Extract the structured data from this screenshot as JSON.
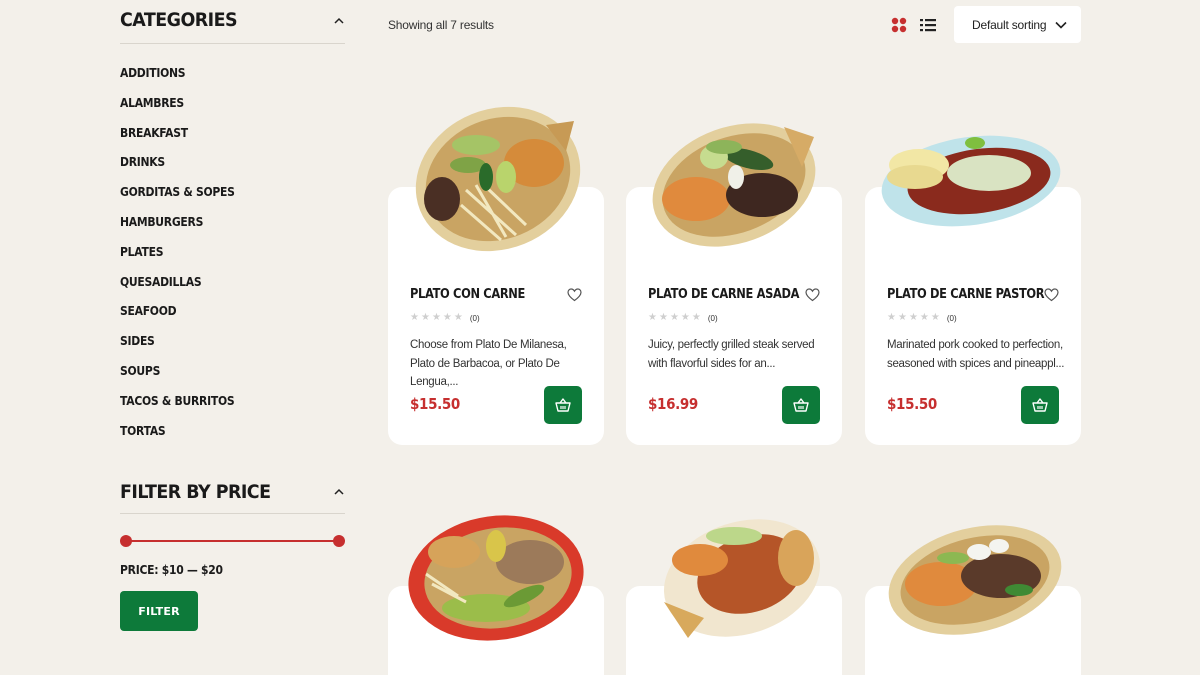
{
  "sidebar": {
    "categories_title": "CATEGORIES",
    "categories": [
      "ADDITIONS",
      "ALAMBRES",
      "BREAKFAST",
      "DRINKS",
      "GORDITAS & SOPES",
      "HAMBURGERS",
      "PLATES",
      "QUESADILLAS",
      "SEAFOOD",
      "SIDES",
      "SOUPS",
      "TACOS & BURRITOS",
      "TORTAS"
    ],
    "price_filter": {
      "title": "FILTER BY PRICE",
      "label": "PRICE: $10 — $20",
      "button": "FILTER"
    }
  },
  "toolbar": {
    "results_text": "Showing all 7 results",
    "sorting": "Default sorting",
    "view_icons": [
      "grid-view-icon",
      "list-view-icon"
    ]
  },
  "products": [
    {
      "title": "PLATO CON CARNE",
      "rating_count": "(0)",
      "description": "Choose from Plato De Milanesa, Plato de Barbacoa, or Plato De Lengua,...",
      "price": "$15.50",
      "stars": 0
    },
    {
      "title": "PLATO DE CARNE ASADA",
      "rating_count": "(0)",
      "description": "Juicy, perfectly grilled steak served with flavorful sides for an...",
      "price": "$16.99",
      "stars": 0
    },
    {
      "title": "PLATO DE CARNE PASTOR",
      "rating_count": "(0)",
      "description": "Marinated pork cooked to perfection, seasoned with spices and pineappl...",
      "price": "$15.50",
      "stars": 0
    }
  ],
  "colors": {
    "background": "#f3f0ea",
    "accent_red": "#c62f2f",
    "accent_green": "#0d7a3a",
    "card": "#ffffff",
    "star_empty": "#cfcfcf"
  }
}
